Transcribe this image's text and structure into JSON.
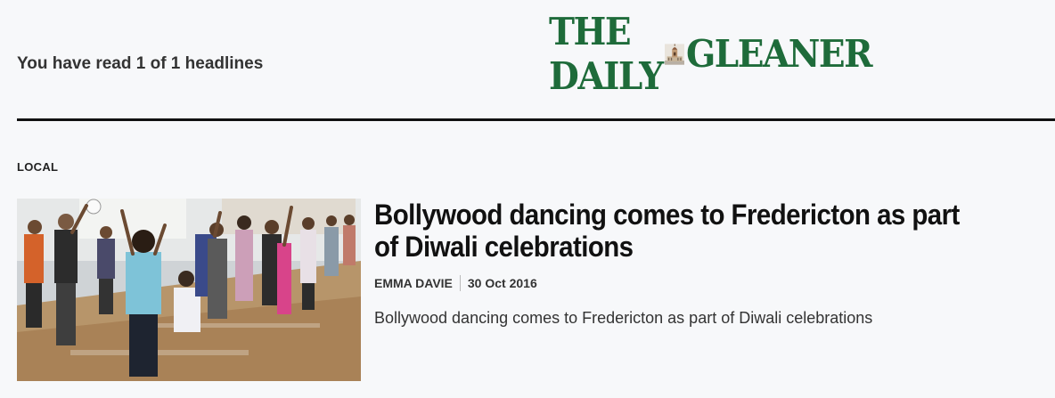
{
  "header": {
    "read_count": "You have read 1 of 1 headlines",
    "masthead_left": "THE DAILY",
    "masthead_right": "GLEANER",
    "brand_color": "#1e6b3a"
  },
  "section": {
    "label": "LOCAL"
  },
  "article": {
    "headline": "Bollywood dancing comes to Fredericton as part of Diwali celebrations",
    "author": "EMMA DAVIE",
    "date": "30 Oct 2016",
    "summary": "Bollywood dancing comes to Fredericton as part of Diwali celebrations",
    "image_icon": "dance-class-photo"
  }
}
